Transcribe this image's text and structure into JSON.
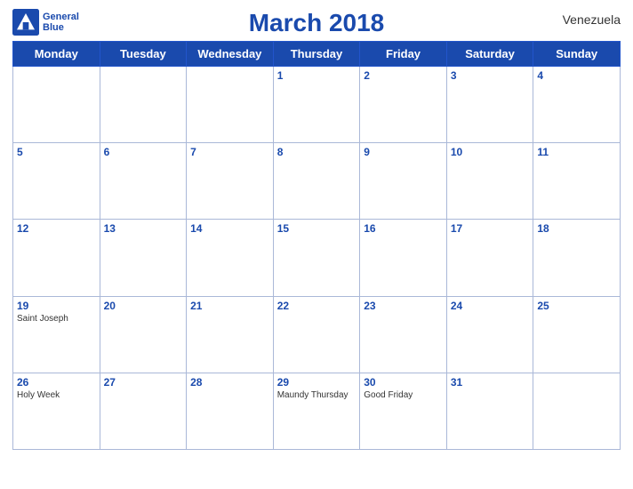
{
  "header": {
    "title": "March 2018",
    "country": "Venezuela",
    "logo_line1": "General",
    "logo_line2": "Blue"
  },
  "weekdays": [
    "Monday",
    "Tuesday",
    "Wednesday",
    "Thursday",
    "Friday",
    "Saturday",
    "Sunday"
  ],
  "weeks": [
    [
      {
        "day": "",
        "holiday": ""
      },
      {
        "day": "",
        "holiday": ""
      },
      {
        "day": "",
        "holiday": ""
      },
      {
        "day": "1",
        "holiday": ""
      },
      {
        "day": "2",
        "holiday": ""
      },
      {
        "day": "3",
        "holiday": ""
      },
      {
        "day": "4",
        "holiday": ""
      }
    ],
    [
      {
        "day": "5",
        "holiday": ""
      },
      {
        "day": "6",
        "holiday": ""
      },
      {
        "day": "7",
        "holiday": ""
      },
      {
        "day": "8",
        "holiday": ""
      },
      {
        "day": "9",
        "holiday": ""
      },
      {
        "day": "10",
        "holiday": ""
      },
      {
        "day": "11",
        "holiday": ""
      }
    ],
    [
      {
        "day": "12",
        "holiday": ""
      },
      {
        "day": "13",
        "holiday": ""
      },
      {
        "day": "14",
        "holiday": ""
      },
      {
        "day": "15",
        "holiday": ""
      },
      {
        "day": "16",
        "holiday": ""
      },
      {
        "day": "17",
        "holiday": ""
      },
      {
        "day": "18",
        "holiday": ""
      }
    ],
    [
      {
        "day": "19",
        "holiday": "Saint Joseph"
      },
      {
        "day": "20",
        "holiday": ""
      },
      {
        "day": "21",
        "holiday": ""
      },
      {
        "day": "22",
        "holiday": ""
      },
      {
        "day": "23",
        "holiday": ""
      },
      {
        "day": "24",
        "holiday": ""
      },
      {
        "day": "25",
        "holiday": ""
      }
    ],
    [
      {
        "day": "26",
        "holiday": "Holy Week"
      },
      {
        "day": "27",
        "holiday": ""
      },
      {
        "day": "28",
        "holiday": ""
      },
      {
        "day": "29",
        "holiday": "Maundy Thursday"
      },
      {
        "day": "30",
        "holiday": "Good Friday"
      },
      {
        "day": "31",
        "holiday": ""
      },
      {
        "day": "",
        "holiday": ""
      }
    ]
  ]
}
